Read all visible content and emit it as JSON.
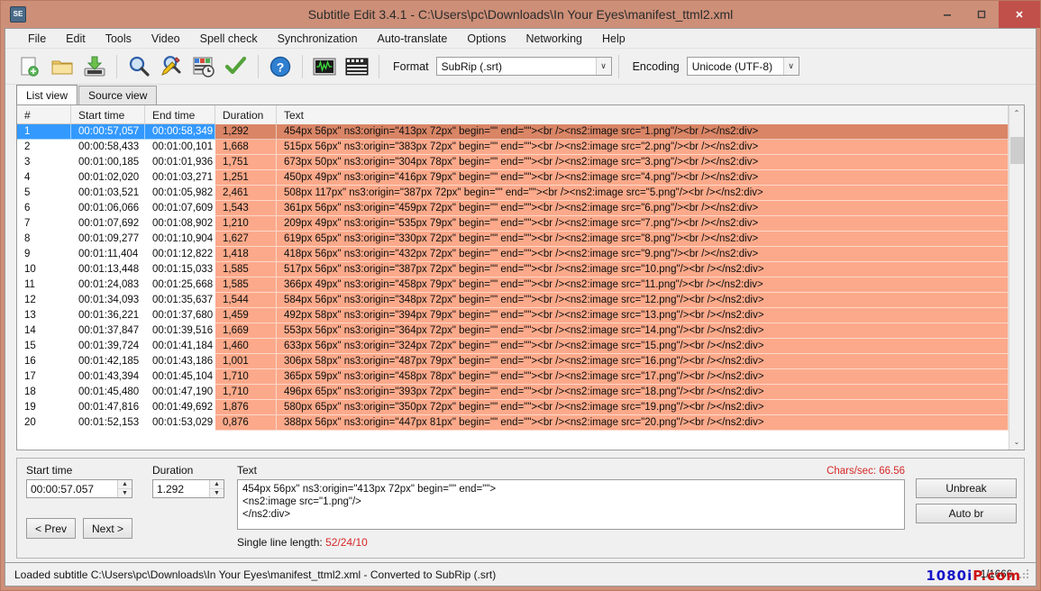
{
  "window": {
    "title": "Subtitle Edit 3.4.1 - C:\\Users\\pc\\Downloads\\In Your Eyes\\manifest_ttml2.xml",
    "app_icon_text": "SE",
    "minimize_label": "–",
    "maximize_label": "□",
    "close_label": "✕",
    "titlebar_color": "#cd8f78",
    "close_color": "#c1504a"
  },
  "menu": {
    "items": [
      {
        "label": "File"
      },
      {
        "label": "Edit"
      },
      {
        "label": "Tools"
      },
      {
        "label": "Video"
      },
      {
        "label": "Spell check"
      },
      {
        "label": "Synchronization"
      },
      {
        "label": "Auto-translate"
      },
      {
        "label": "Options"
      },
      {
        "label": "Networking"
      },
      {
        "label": "Help"
      }
    ]
  },
  "toolbar": {
    "buttons": [
      {
        "name": "new-subtitle-icon",
        "title": "New"
      },
      {
        "name": "open-folder-icon",
        "title": "Open"
      },
      {
        "name": "save-icon",
        "title": "Save"
      },
      {
        "name": "find-icon",
        "title": "Find"
      },
      {
        "name": "replace-icon",
        "title": "Replace"
      },
      {
        "name": "sync-time-icon",
        "title": "Visual sync"
      },
      {
        "name": "spell-check-icon",
        "title": "Spell check"
      },
      {
        "name": "help-icon",
        "title": "Help"
      },
      {
        "name": "waveform-icon",
        "title": "Waveform"
      },
      {
        "name": "video-icon",
        "title": "Video"
      }
    ],
    "format_label": "Format",
    "format_value": "SubRip (.srt)",
    "encoding_label": "Encoding",
    "encoding_value": "Unicode (UTF-8)",
    "dropdown_arrow": "∨"
  },
  "tabs": [
    {
      "label": "List view",
      "active": true
    },
    {
      "label": "Source view",
      "active": false
    }
  ],
  "grid": {
    "columns": [
      "#",
      "Start time",
      "End time",
      "Duration",
      "Text"
    ],
    "selected_index": 0,
    "rows": [
      {
        "num": "1",
        "start": "00:00:57,057",
        "end": "00:00:58,349",
        "duration": "1,292",
        "text": "454px 56px\" ns3:origin=\"413px 72px\" begin=\"\" end=\"\"><br /><ns2:image src=\"1.png\"/><br /></ns2:div>"
      },
      {
        "num": "2",
        "start": "00:00:58,433",
        "end": "00:01:00,101",
        "duration": "1,668",
        "text": "515px 56px\" ns3:origin=\"383px 72px\" begin=\"\" end=\"\"><br /><ns2:image src=\"2.png\"/><br /></ns2:div>"
      },
      {
        "num": "3",
        "start": "00:01:00,185",
        "end": "00:01:01,936",
        "duration": "1,751",
        "text": "673px 50px\" ns3:origin=\"304px 78px\" begin=\"\" end=\"\"><br /><ns2:image src=\"3.png\"/><br /></ns2:div>"
      },
      {
        "num": "4",
        "start": "00:01:02,020",
        "end": "00:01:03,271",
        "duration": "1,251",
        "text": "450px 49px\" ns3:origin=\"416px 79px\" begin=\"\" end=\"\"><br /><ns2:image src=\"4.png\"/><br /></ns2:div>"
      },
      {
        "num": "5",
        "start": "00:01:03,521",
        "end": "00:01:05,982",
        "duration": "2,461",
        "text": "508px 117px\" ns3:origin=\"387px 72px\" begin=\"\" end=\"\"><br /><ns2:image src=\"5.png\"/><br /></ns2:div>"
      },
      {
        "num": "6",
        "start": "00:01:06,066",
        "end": "00:01:07,609",
        "duration": "1,543",
        "text": "361px 56px\" ns3:origin=\"459px 72px\" begin=\"\" end=\"\"><br /><ns2:image src=\"6.png\"/><br /></ns2:div>"
      },
      {
        "num": "7",
        "start": "00:01:07,692",
        "end": "00:01:08,902",
        "duration": "1,210",
        "text": "209px 49px\" ns3:origin=\"535px 79px\" begin=\"\" end=\"\"><br /><ns2:image src=\"7.png\"/><br /></ns2:div>"
      },
      {
        "num": "8",
        "start": "00:01:09,277",
        "end": "00:01:10,904",
        "duration": "1,627",
        "text": "619px 65px\" ns3:origin=\"330px 72px\" begin=\"\" end=\"\"><br /><ns2:image src=\"8.png\"/><br /></ns2:div>"
      },
      {
        "num": "9",
        "start": "00:01:11,404",
        "end": "00:01:12,822",
        "duration": "1,418",
        "text": "418px 56px\" ns3:origin=\"432px 72px\" begin=\"\" end=\"\"><br /><ns2:image src=\"9.png\"/><br /></ns2:div>"
      },
      {
        "num": "10",
        "start": "00:01:13,448",
        "end": "00:01:15,033",
        "duration": "1,585",
        "text": "517px 56px\" ns3:origin=\"387px 72px\" begin=\"\" end=\"\"><br /><ns2:image src=\"10.png\"/><br /></ns2:div>"
      },
      {
        "num": "11",
        "start": "00:01:24,083",
        "end": "00:01:25,668",
        "duration": "1,585",
        "text": "366px 49px\" ns3:origin=\"458px 79px\" begin=\"\" end=\"\"><br /><ns2:image src=\"11.png\"/><br /></ns2:div>"
      },
      {
        "num": "12",
        "start": "00:01:34,093",
        "end": "00:01:35,637",
        "duration": "1,544",
        "text": "584px 56px\" ns3:origin=\"348px 72px\" begin=\"\" end=\"\"><br /><ns2:image src=\"12.png\"/><br /></ns2:div>"
      },
      {
        "num": "13",
        "start": "00:01:36,221",
        "end": "00:01:37,680",
        "duration": "1,459",
        "text": "492px 58px\" ns3:origin=\"394px 79px\" begin=\"\" end=\"\"><br /><ns2:image src=\"13.png\"/><br /></ns2:div>"
      },
      {
        "num": "14",
        "start": "00:01:37,847",
        "end": "00:01:39,516",
        "duration": "1,669",
        "text": "553px 56px\" ns3:origin=\"364px 72px\" begin=\"\" end=\"\"><br /><ns2:image src=\"14.png\"/><br /></ns2:div>"
      },
      {
        "num": "15",
        "start": "00:01:39,724",
        "end": "00:01:41,184",
        "duration": "1,460",
        "text": "633px 56px\" ns3:origin=\"324px 72px\" begin=\"\" end=\"\"><br /><ns2:image src=\"15.png\"/><br /></ns2:div>"
      },
      {
        "num": "16",
        "start": "00:01:42,185",
        "end": "00:01:43,186",
        "duration": "1,001",
        "text": "306px 58px\" ns3:origin=\"487px 79px\" begin=\"\" end=\"\"><br /><ns2:image src=\"16.png\"/><br /></ns2:div>"
      },
      {
        "num": "17",
        "start": "00:01:43,394",
        "end": "00:01:45,104",
        "duration": "1,710",
        "text": "365px 59px\" ns3:origin=\"458px 78px\" begin=\"\" end=\"\"><br /><ns2:image src=\"17.png\"/><br /></ns2:div>"
      },
      {
        "num": "18",
        "start": "00:01:45,480",
        "end": "00:01:47,190",
        "duration": "1,710",
        "text": "496px 65px\" ns3:origin=\"393px 72px\" begin=\"\" end=\"\"><br /><ns2:image src=\"18.png\"/><br /></ns2:div>"
      },
      {
        "num": "19",
        "start": "00:01:47,816",
        "end": "00:01:49,692",
        "duration": "1,876",
        "text": "580px 65px\" ns3:origin=\"350px 72px\" begin=\"\" end=\"\"><br /><ns2:image src=\"19.png\"/><br /></ns2:div>"
      },
      {
        "num": "20",
        "start": "00:01:52,153",
        "end": "00:01:53,029",
        "duration": "0,876",
        "text": "388px 56px\" ns3:origin=\"447px 81px\" begin=\"\" end=\"\"><br /><ns2:image src=\"20.png\"/><br /></ns2:div>"
      }
    ],
    "selected_row_color": "#3399ff",
    "row_highlight_color": "#fba98a",
    "scroll_up_arrow": "⌃",
    "scroll_down_arrow": "⌄"
  },
  "editor": {
    "start_time_label": "Start time",
    "start_time_value": "00:00:57.057",
    "duration_label": "Duration",
    "duration_value": "1.292",
    "prev_label": "< Prev",
    "next_label": "Next >",
    "text_label": "Text",
    "chars_per_sec": "Chars/sec: 66.56",
    "text_value": "454px 56px\" ns3:origin=\"413px 72px\" begin=\"\" end=\"\">\n<ns2:image src=\"1.png\"/>\n</ns2:div>",
    "line_length_label": "Single line length:",
    "line_length_value": "52/24/10",
    "unbreak_label": "Unbreak",
    "autobr_label": "Auto br",
    "spin_up": "▲",
    "spin_down": "▼",
    "warning_color": "#d62828"
  },
  "statusbar": {
    "message": "Loaded subtitle C:\\Users\\pc\\Downloads\\In Your Eyes\\manifest_ttml2.xml - Converted to SubRip (.srt)",
    "counter": "1/1666"
  },
  "watermark": {
    "part1": "1080i",
    "part2": "P.com"
  }
}
